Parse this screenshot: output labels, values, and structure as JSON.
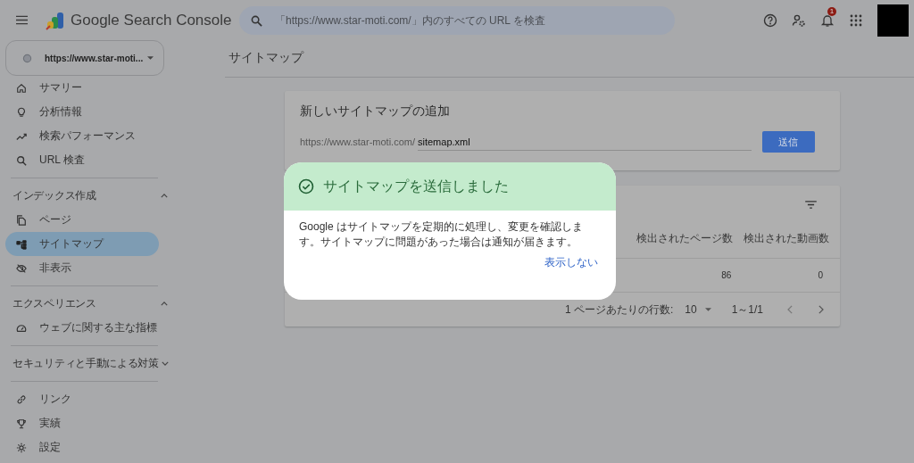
{
  "header": {
    "app_title": "Google Search Console",
    "search": {
      "placeholder": "「https://www.star-moti.com/」内のすべての URL を検査"
    },
    "notification_count": "1"
  },
  "property_selector": {
    "value": "https://www.star-moti..."
  },
  "sidebar": {
    "groups": [
      {
        "items": [
          {
            "label": "サマリー",
            "kind": "home",
            "selected": false
          },
          {
            "label": "分析情報",
            "kind": "bulb",
            "selected": false
          },
          {
            "label": "検索パフォーマンス",
            "kind": "trend",
            "selected": false
          },
          {
            "label": "URL 検査",
            "kind": "search",
            "selected": false
          }
        ]
      },
      {
        "title": "インデックス作成",
        "expanded": true,
        "items": [
          {
            "label": "ページ",
            "kind": "pages",
            "selected": false
          },
          {
            "label": "サイトマップ",
            "kind": "sitemap",
            "selected": true
          },
          {
            "label": "非表示",
            "kind": "hidden",
            "selected": false
          }
        ]
      },
      {
        "title": "エクスペリエンス",
        "expanded": true,
        "items": [
          {
            "label": "ウェブに関する主な指標",
            "kind": "gauge",
            "selected": false
          }
        ]
      },
      {
        "title": "セキュリティと手動による対策",
        "expanded": false
      },
      {
        "items": [
          {
            "label": "リンク",
            "kind": "link",
            "selected": false
          },
          {
            "label": "実績",
            "kind": "trophy",
            "selected": false
          },
          {
            "label": "設定",
            "kind": "gear",
            "selected": false
          }
        ]
      }
    ]
  },
  "page_title": "サイトマップ",
  "add_card": {
    "title": "新しいサイトマップの追加",
    "prefix": "https://www.star-moti.com/",
    "value": "sitemap.xml",
    "submit": "送信"
  },
  "table_card": {
    "columns": [
      "検出されたページ数",
      "検出された動画数"
    ],
    "rows": [
      {
        "pages": "86",
        "videos": "0"
      }
    ],
    "pagination": {
      "rows_label": "1 ページあたりの行数:",
      "rows_value": "10",
      "range": "1～1/1"
    }
  },
  "dialog": {
    "title": "サイトマップを送信しました",
    "body": "Google はサイトマップを定期的に処理し、変更を確認します。サイトマップに問題があった場合は通知が届きます。",
    "action": "表示しない"
  }
}
